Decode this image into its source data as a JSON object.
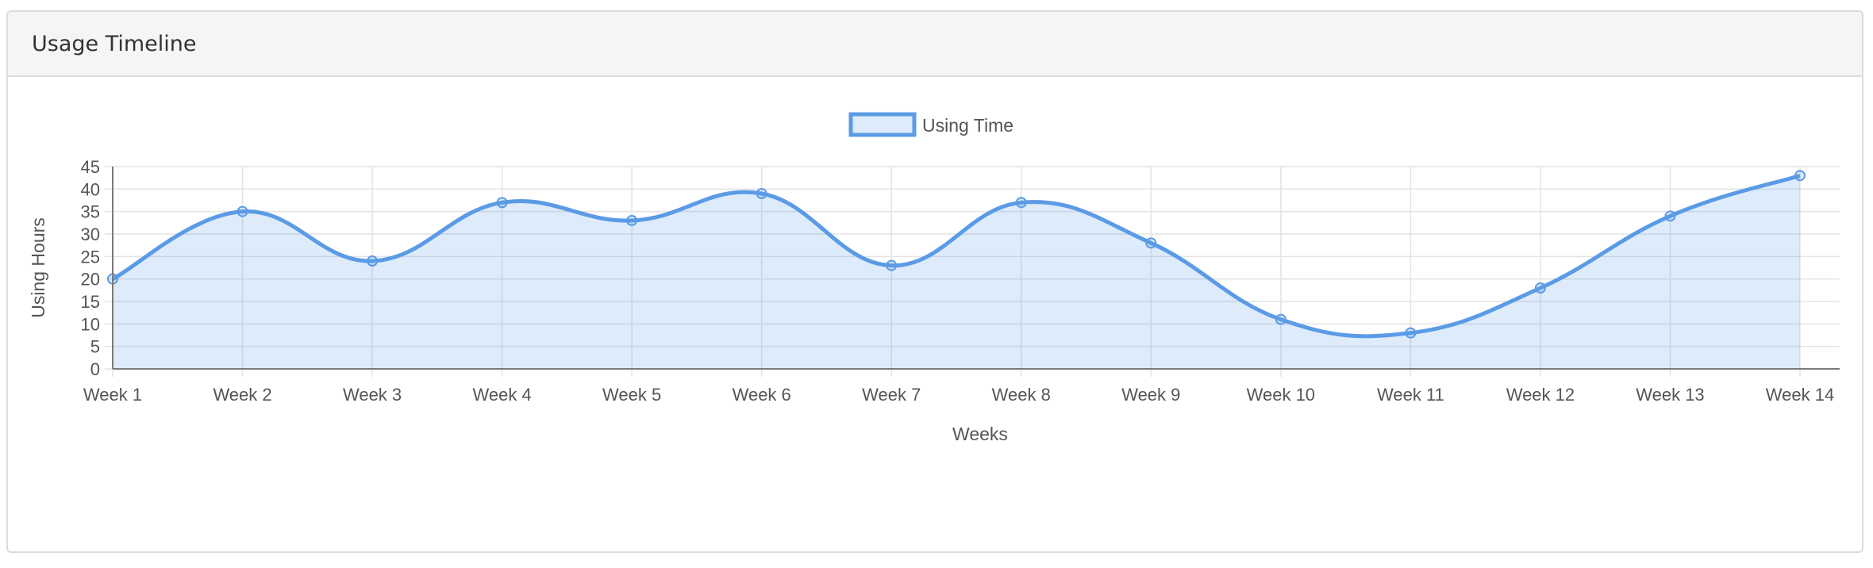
{
  "panel": {
    "title": "Usage Timeline"
  },
  "colors": {
    "line": "#5b9be6",
    "fill": "rgba(91,155,230,0.2)",
    "grid": "#e3e3e3",
    "axis": "#7a7a7a",
    "text": "#555555"
  },
  "chart_data": {
    "type": "area",
    "title": "",
    "xlabel": "Weeks",
    "ylabel": "Using Hours",
    "categories": [
      "Week 1",
      "Week 2",
      "Week 3",
      "Week 4",
      "Week 5",
      "Week 6",
      "Week 7",
      "Week 8",
      "Week 9",
      "Week 10",
      "Week 11",
      "Week 12",
      "Week 13",
      "Week 14"
    ],
    "series": [
      {
        "name": "Using Time",
        "values": [
          20,
          35,
          24,
          37,
          33,
          39,
          23,
          37,
          28,
          11,
          8,
          18,
          34,
          43
        ]
      }
    ],
    "ylim": [
      0,
      45
    ],
    "yticks": [
      0,
      5,
      10,
      15,
      20,
      25,
      30,
      35,
      40,
      45
    ],
    "grid": true,
    "legend_position": "top-center",
    "curve": "smooth"
  }
}
